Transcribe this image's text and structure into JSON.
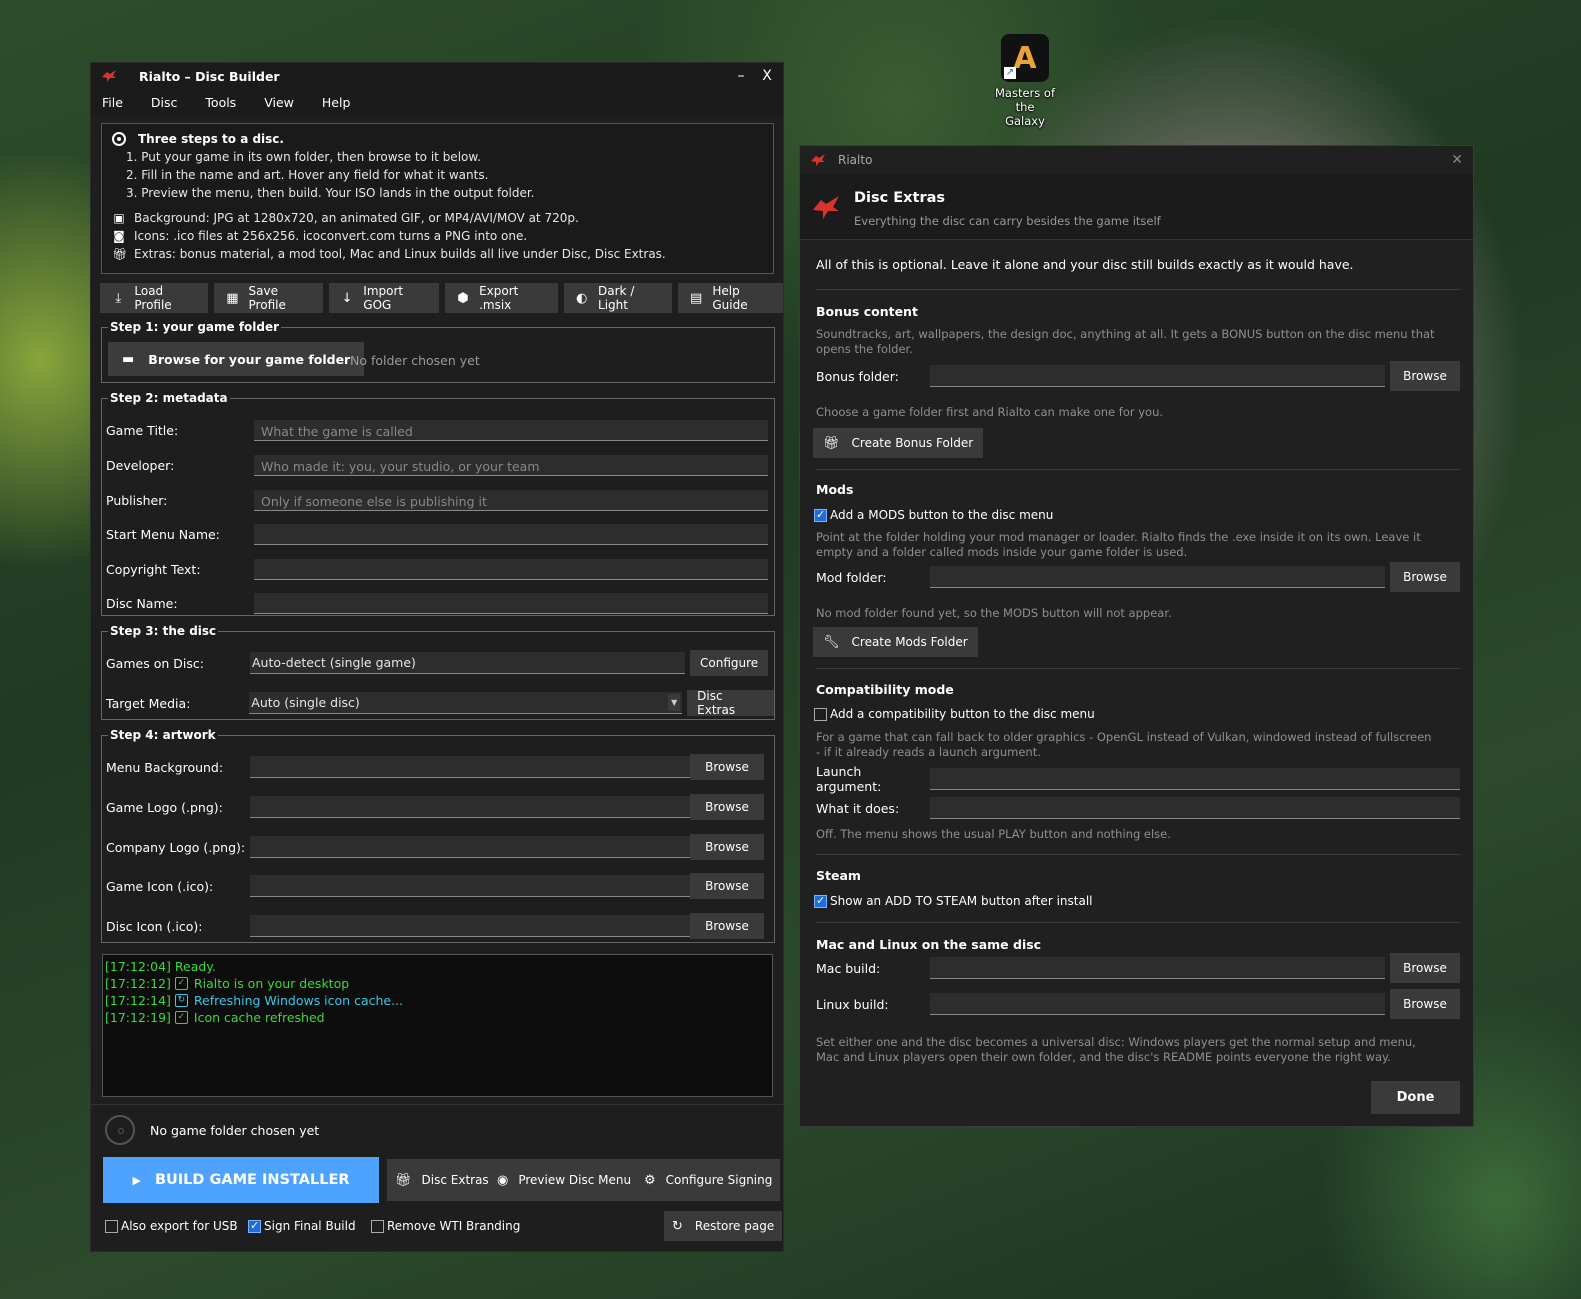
{
  "desktop": {
    "icon_label": "Masters of the Galaxy"
  },
  "main": {
    "title": "Rialto – Disc Builder",
    "minimize": "–",
    "close": "X",
    "menu": [
      "File",
      "Disc",
      "Tools",
      "View",
      "Help"
    ],
    "info": {
      "heading": "Three steps to a disc.",
      "steps": [
        "1.  Put your game in its own folder, then browse to it below.",
        "2.  Fill in the name and art. Hover any field for what it wants.",
        "3.  Preview the menu, then build. Your ISO lands in the output folder."
      ],
      "tips": [
        "Background: JPG at 1280x720, an animated GIF, or MP4/AVI/MOV at 720p.",
        "Icons: .ico files at 256x256. icoconvert.com turns a PNG into one.",
        "Extras: bonus material, a mod tool, Mac and Linux builds all live under Disc, Disc Extras."
      ]
    },
    "toolbar": [
      "Load Profile",
      "Save Profile",
      "Import GOG",
      "Export .msix",
      "Dark / Light",
      "Help Guide"
    ],
    "step1": {
      "legend": "Step 1: your game folder",
      "browse": "Browse for your game folder",
      "status": "No folder chosen yet"
    },
    "step2": {
      "legend": "Step 2: metadata",
      "fields": [
        {
          "label": "Game Title:",
          "placeholder": "What the game is called"
        },
        {
          "label": "Developer:",
          "placeholder": "Who made it: you, your studio, or your team"
        },
        {
          "label": "Publisher:",
          "placeholder": "Only if someone else is publishing it"
        },
        {
          "label": "Start Menu Name:",
          "placeholder": ""
        },
        {
          "label": "Copyright Text:",
          "placeholder": ""
        },
        {
          "label": "Disc Name:",
          "placeholder": ""
        }
      ]
    },
    "step3": {
      "legend": "Step 3: the disc",
      "games_label": "Games on Disc:",
      "games_value": "Auto-detect (single game)",
      "configure": "Configure",
      "media_label": "Target Media:",
      "media_value": "Auto (single disc)",
      "extras": "Disc Extras"
    },
    "step4": {
      "legend": "Step 4: artwork",
      "browse": "Browse",
      "fields": [
        "Menu Background:",
        "Game Logo (.png):",
        "Company Logo (.png):",
        "Game Icon (.ico):",
        "Disc Icon (.ico):"
      ]
    },
    "log": [
      {
        "ts": "[17:12:04]",
        "msg": "Ready."
      },
      {
        "ts": "[17:12:12]",
        "msg": "Rialto is on your desktop"
      },
      {
        "ts": "[17:12:14]",
        "msg": "Refreshing Windows icon cache..."
      },
      {
        "ts": "[17:12:19]",
        "msg": "Icon cache refreshed"
      }
    ],
    "status_text": "No game folder chosen yet",
    "build": "BUILD GAME INSTALLER",
    "actions": [
      "Disc Extras",
      "Preview Disc Menu",
      "Configure Signing"
    ],
    "checks": [
      {
        "label": "Also export for USB",
        "checked": false
      },
      {
        "label": "Sign Final Build",
        "checked": true
      },
      {
        "label": "Remove WTI Branding",
        "checked": false
      }
    ],
    "restore": "Restore page"
  },
  "extras": {
    "window_title": "Rialto",
    "close": "✕",
    "title": "Disc Extras",
    "subtitle": "Everything the disc can carry besides the game itself",
    "intro": "All of this is optional. Leave it alone and your disc still builds exactly as it would have.",
    "browse": "Browse",
    "bonus": {
      "heading": "Bonus content",
      "desc": "Soundtracks, art, wallpapers, the design doc, anything at all. It gets a BONUS button on the disc menu that opens the folder.",
      "folder_label": "Bonus folder:",
      "note": "Choose a game folder first and Rialto can make one for you.",
      "create": "Create Bonus Folder"
    },
    "mods": {
      "heading": "Mods",
      "check": "Add a MODS button to the disc menu",
      "checked": true,
      "desc": "Point at the folder holding your mod manager or loader. Rialto finds the .exe inside it on its own. Leave it empty and a folder called mods inside your game folder is used.",
      "folder_label": "Mod folder:",
      "note": "No mod folder found yet, so the MODS button will not appear.",
      "create": "Create Mods Folder"
    },
    "compat": {
      "heading": "Compatibility mode",
      "check": "Add a compatibility button to the disc menu",
      "checked": false,
      "desc": "For a game that can fall back to older graphics - OpenGL instead of Vulkan, windowed instead of fullscreen - if it already reads a launch argument.",
      "arg_label": "Launch argument:",
      "does_label": "What it does:",
      "note": "Off. The menu shows the usual PLAY button and nothing else."
    },
    "steam": {
      "heading": "Steam",
      "check": "Show an ADD TO STEAM button after install",
      "checked": true
    },
    "maclinux": {
      "heading": "Mac and Linux on the same disc",
      "mac_label": "Mac build:",
      "linux_label": "Linux build:",
      "desc": "Set either one and the disc becomes a universal disc: Windows players get the normal setup and menu, Mac and Linux players open their own folder, and the disc's README points everyone the right way."
    },
    "done": "Done"
  }
}
